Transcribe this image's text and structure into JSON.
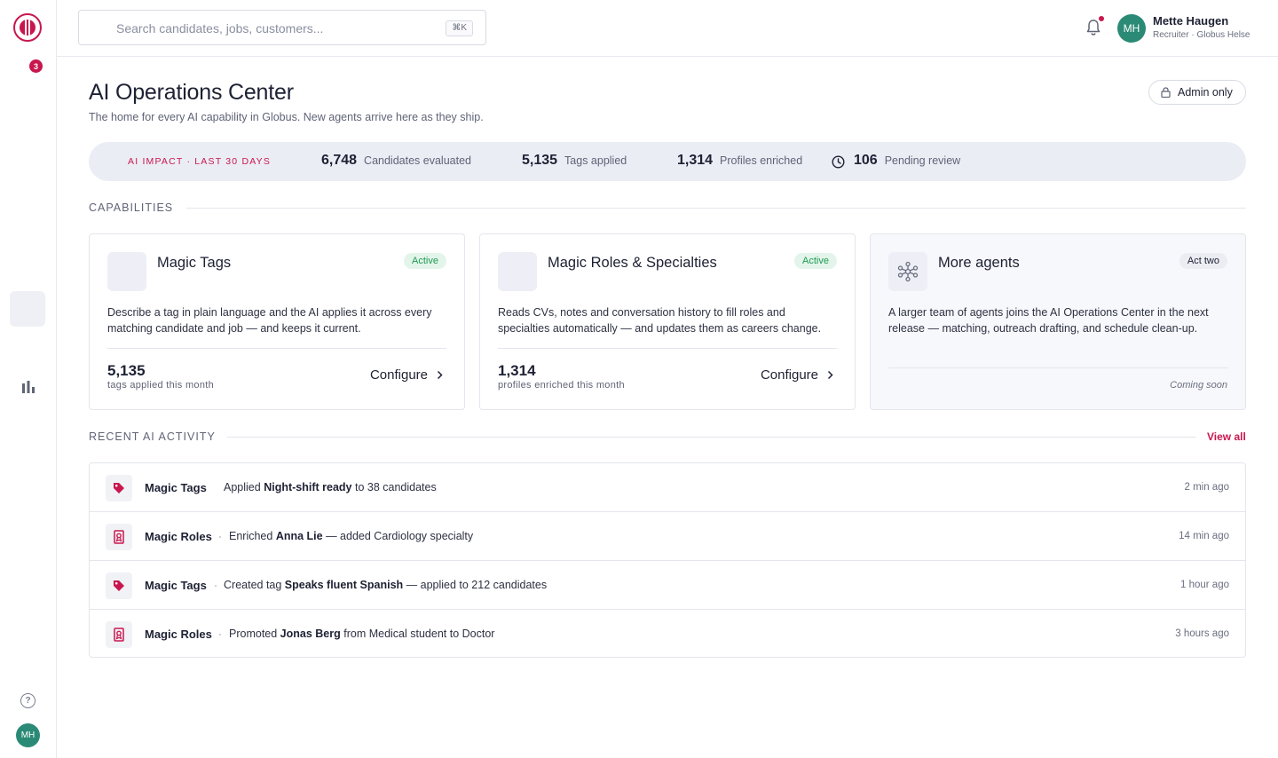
{
  "sidebar": {
    "notification_count": "3",
    "help_glyph": "?",
    "avatar_initials": "MH",
    "icons": [
      "logo-icon",
      "bar-chart-icon",
      "help-icon"
    ]
  },
  "header": {
    "search_placeholder": "Search candidates, jobs, customers...",
    "shortcut": "⌘K",
    "user": {
      "initials": "MH",
      "name": "Mette Haugen",
      "role": "Recruiter · Globus Helse"
    }
  },
  "page": {
    "title": "AI Operations Center",
    "subtitle": "The home for every AI capability in Globus. New agents arrive here as they ship.",
    "admin_label": "Admin only"
  },
  "impact": {
    "label": "AI IMPACT · LAST 30 DAYS",
    "metrics": [
      {
        "value": "6,748",
        "label": "Candidates evaluated"
      },
      {
        "value": "5,135",
        "label": "Tags applied"
      },
      {
        "value": "1,314",
        "label": "Profiles enriched"
      },
      {
        "value": "106",
        "label": "Pending review"
      }
    ]
  },
  "capabilities": {
    "heading": "CAPABILITIES",
    "cards": [
      {
        "title": "Magic Tags",
        "status": "Active",
        "description": "Describe a tag in plain language and the AI applies it across every matching candidate and job — and keeps it current.",
        "stat_value": "5,135",
        "stat_label": "tags applied this month",
        "action": "Configure"
      },
      {
        "title": "Magic Roles & Specialties",
        "status": "Active",
        "description": "Reads CVs, notes and conversation history to fill roles and specialties automatically — and updates them as careers change.",
        "stat_value": "1,314",
        "stat_label": "profiles enriched this month",
        "action": "Configure"
      },
      {
        "title": "More agents",
        "status": "Act two",
        "description": "A larger team of agents joins the AI Operations Center in the next release — matching, outreach drafting, and schedule clean-up.",
        "footer": "Coming soon"
      }
    ]
  },
  "activity": {
    "heading": "RECENT AI ACTIVITY",
    "view_all": "View all",
    "rows": [
      {
        "source": "Magic Tags",
        "pre": "Applied ",
        "bold": "Night-shift ready",
        "post": " to 38 candidates",
        "time": "2 min ago",
        "icon": "tag-icon"
      },
      {
        "source": "Magic Roles",
        "pre": "Enriched ",
        "bold": "Anna Lie",
        "post": " — added Cardiology specialty",
        "time": "14 min ago",
        "icon": "award-icon"
      },
      {
        "source": "Magic Tags",
        "pre": "Created tag ",
        "bold": "Speaks fluent Spanish",
        "post": " — applied to 212 candidates",
        "time": "1 hour ago",
        "icon": "tag-icon"
      },
      {
        "source": "Magic Roles",
        "pre": "Promoted ",
        "bold": "Jonas Berg",
        "post": " from Medical student to Doctor",
        "time": "3 hours ago",
        "icon": "award-icon"
      }
    ]
  },
  "colors": {
    "brand": "#c8174e",
    "active_badge_bg": "#e3f5ea",
    "active_badge_text": "#1f9a55",
    "avatar": "#2a8a76"
  }
}
